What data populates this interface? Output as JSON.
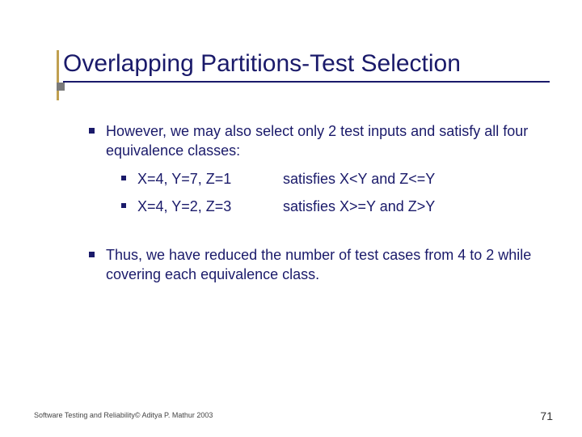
{
  "title": "Overlapping Partitions-Test Selection",
  "bullets": [
    {
      "text": "However, we may also select only 2 test inputs and satisfy all four equivalence classes:",
      "sub": [
        {
          "values": "X=4, Y=7, Z=1",
          "condition": "satisfies X<Y and Z<=Y"
        },
        {
          "values": "X=4, Y=2, Z=3",
          "condition": "satisfies X>=Y and Z>Y"
        }
      ]
    },
    {
      "text": "Thus, we have reduced the number of test cases from 4 to 2 while covering each equivalence class."
    }
  ],
  "footer": "Software Testing and Reliability© Aditya P. Mathur 2003",
  "page": "71"
}
